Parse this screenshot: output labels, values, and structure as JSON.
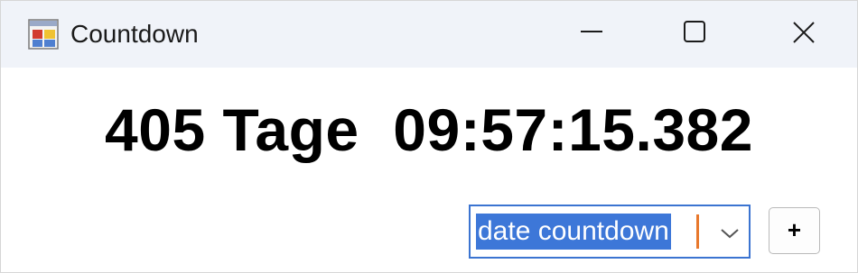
{
  "window": {
    "title": "Countdown",
    "icon": "app-window-icon",
    "caption_buttons": [
      "minimize-icon",
      "maximize-icon",
      "close-icon"
    ]
  },
  "countdown": {
    "display": "405 Tage  09:57:15.382"
  },
  "mode_select": {
    "selected": "date countdown",
    "selection_color": "#3d77d8"
  },
  "add_button": {
    "label": "+"
  }
}
